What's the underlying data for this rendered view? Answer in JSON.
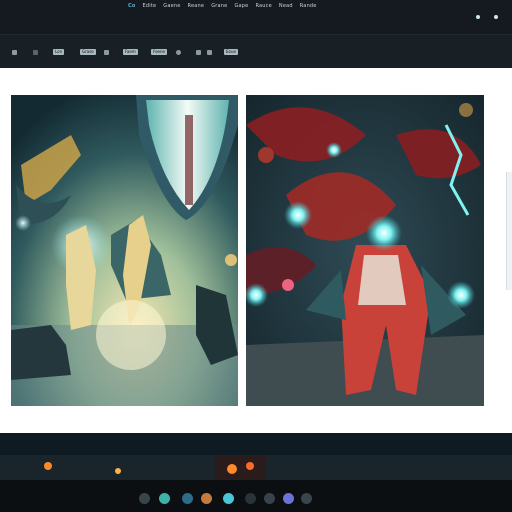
{
  "app": {
    "menu": [
      "Co",
      "Edite",
      "Gaene",
      "Reane",
      "Grane",
      "Gape",
      "Rauce",
      "Nead",
      "Rande"
    ]
  },
  "toolbar": {
    "items": [
      "Lon",
      "Grase",
      "Faem",
      "Feene",
      "Eoue"
    ]
  },
  "gallery": {
    "images": [
      {
        "name": "fantasy-heroes-battle-artwork"
      },
      {
        "name": "red-cloaked-knight-artwork"
      }
    ]
  },
  "colors": {
    "accent": "#56b4d0",
    "glow": "#5fe3e8",
    "fire": "#ff8a2a"
  }
}
